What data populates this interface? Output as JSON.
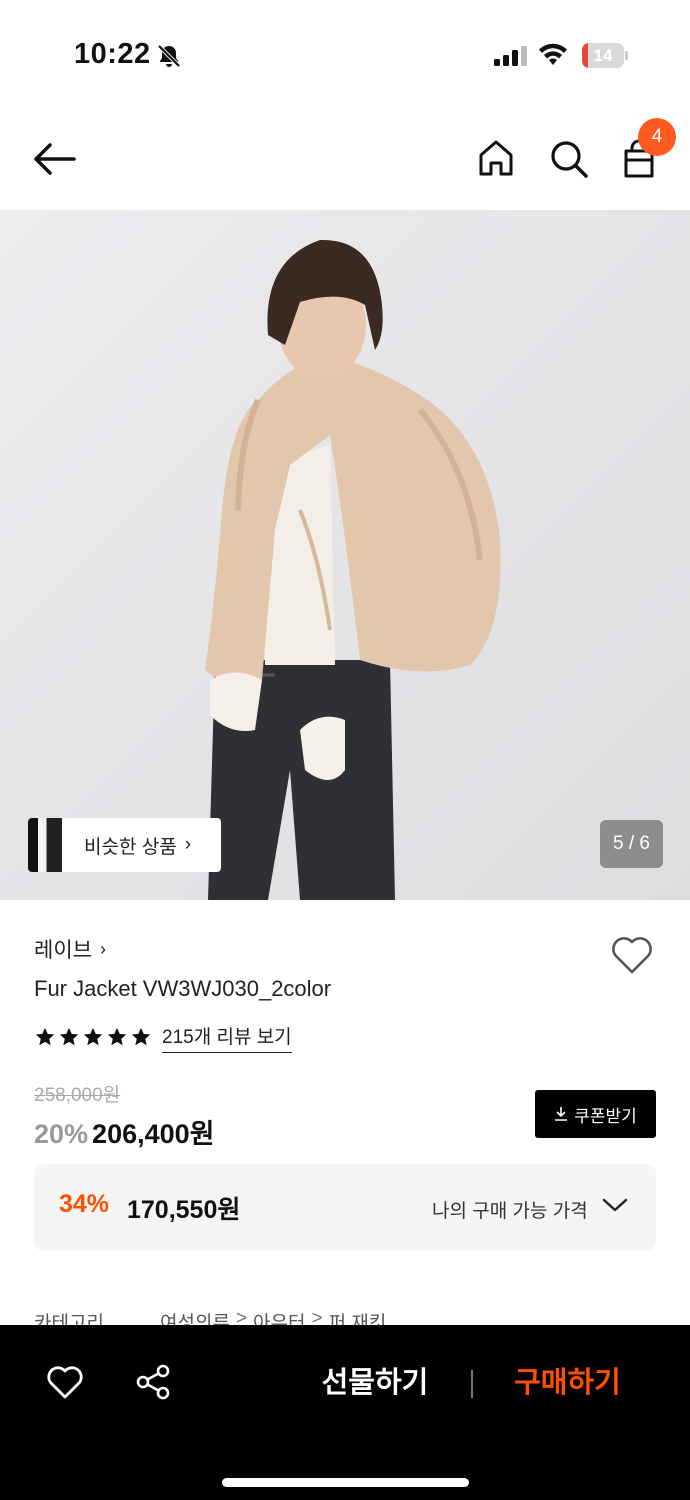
{
  "status_bar": {
    "time": "10:22",
    "battery_level": "14",
    "battery_fraction": 0.14,
    "icons": [
      "bell-slash-icon",
      "cellular-signal-icon",
      "wifi-icon",
      "battery-icon"
    ]
  },
  "nav": {
    "icons": [
      "back-arrow-icon",
      "home-icon",
      "search-icon",
      "shopping-bag-icon"
    ],
    "cart_count": "4"
  },
  "gallery": {
    "similar_label": "비슷한 상품",
    "similar_chevron": "›",
    "page_indicator": "5 / 6"
  },
  "product": {
    "brand": "레이브",
    "brand_chevron": "›",
    "name": "Fur Jacket VW3WJ030_2color",
    "rating_stars": 5,
    "review_link": "215개 리뷰 보기",
    "original_price": "258,000원",
    "discount_rate": "20%",
    "sale_price": "206,400원",
    "coupon_label": "쿠폰받기"
  },
  "my_price": {
    "discount_rate": "34%",
    "price": "170,550원",
    "label": "나의 구매 가능 가격"
  },
  "category": {
    "label": "카테고리",
    "crumbs": [
      "여성의류",
      "아우터",
      "퍼 재킷"
    ],
    "separator": ">"
  },
  "bottom_bar": {
    "gift_label": "선물하기",
    "buy_label": "구매하기"
  },
  "colors": {
    "accent": "#ff4f00",
    "badge": "#ff5a1f",
    "bottom_bar_bg": "#000000",
    "my_price_bg": "#f5f5f6"
  }
}
